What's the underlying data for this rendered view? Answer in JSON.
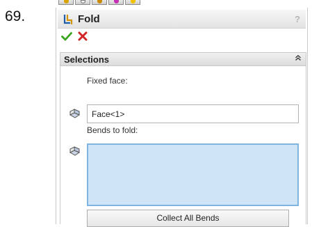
{
  "step_number": "69.",
  "panel": {
    "title": "Fold",
    "help_label": "?"
  },
  "actions": {
    "ok_icon": "checkmark-icon",
    "cancel_icon": "x-close-icon"
  },
  "selections": {
    "title": "Selections",
    "collapse_symbol": "⌃",
    "fixed_face_label": "Fixed face:",
    "fixed_face_value": "Face<1>",
    "bends_label": "Bends to fold:",
    "bends_items": [],
    "collect_button_label": "Collect All Bends"
  },
  "colors": {
    "ok_green": "#3aa31c",
    "cancel_red": "#d22525",
    "list_selected_blue": "#cfe4f7",
    "list_border_blue": "#7fb4e0"
  }
}
